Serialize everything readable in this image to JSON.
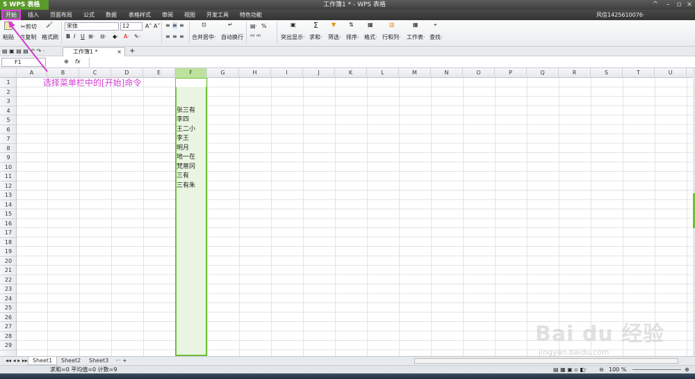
{
  "app": {
    "logo": "5 WPS 表格",
    "title": "工作簿1 * - WPS 表格"
  },
  "menu": {
    "items": [
      "开始",
      "插入",
      "页面布局",
      "公式",
      "数据",
      "表格样式",
      "审阅",
      "视图",
      "开发工具",
      "特色功能"
    ],
    "user": "风信1425610076·"
  },
  "ribbon": {
    "paste": "粘贴",
    "cut": "剪切",
    "copy": "复制",
    "format_painter": "格式刷",
    "font_name": "宋体",
    "font_size": "12",
    "bold": "B",
    "italic": "I",
    "underline": "U",
    "merge": "合并居中·",
    "wrap": "自动换行",
    "percent": "%",
    "highlight": "突出显示·",
    "sum": "求和·",
    "filter": "筛选·",
    "sort": "排序·",
    "format": "格式·",
    "rowcol": "行和列·",
    "sheet": "工作表·",
    "find": "查找·"
  },
  "tabs": {
    "doc": "工作簿1 *",
    "plus": "+"
  },
  "formula": {
    "cell_ref": "F1",
    "fx": "fx"
  },
  "columns": [
    "A",
    "B",
    "C",
    "D",
    "E",
    "F",
    "G",
    "H",
    "I",
    "J",
    "K",
    "L",
    "M",
    "N",
    "O",
    "P",
    "Q",
    "R",
    "S",
    "T",
    "U"
  ],
  "rows": [
    "1",
    "2",
    "3",
    "4",
    "5",
    "6",
    "7",
    "8",
    "9",
    "10",
    "11",
    "12",
    "13",
    "14",
    "15",
    "16",
    "17",
    "18",
    "19",
    "20",
    "21",
    "22",
    "23",
    "24",
    "25",
    "26",
    "27",
    "28",
    "29"
  ],
  "annotation": "选择菜单栏中的[开始]命令",
  "cells_F": [
    "张三有",
    "李四",
    "王二小",
    "李王",
    "明月",
    "地一在",
    "梵蒂冈",
    "三有",
    "三有朱"
  ],
  "sheets": [
    "Sheet1",
    "Sheet2",
    "Sheet3"
  ],
  "status": {
    "summary": "求和=0  平均值=0  计数=9",
    "zoom": "100 %"
  },
  "watermark": {
    "main": "Bai du 经验",
    "sub": "jingyan.baidu.com"
  },
  "colors": {
    "accent": "#6fbf3a",
    "annotation": "#d23bd2"
  }
}
